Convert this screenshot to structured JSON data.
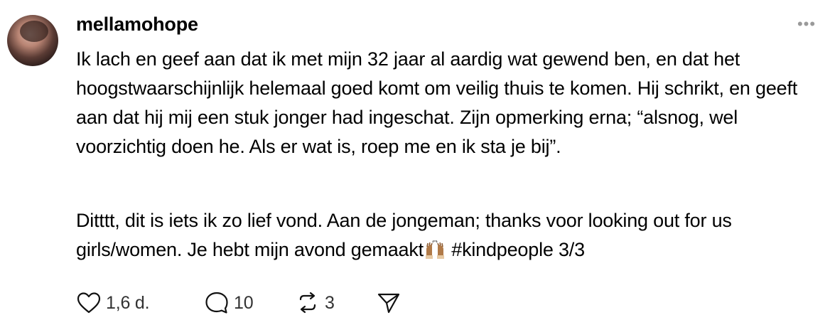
{
  "post": {
    "username": "mellamohope",
    "more_label": "•••",
    "paragraph1": "Ik lach en geef aan dat ik met mijn 32 jaar al aardig wat gewend ben, en dat het hoogstwaarschijnlijk helemaal goed komt om veilig thuis te komen. Hij schrikt, en geeft aan dat hij mij een stuk jonger had ingeschat. Zijn opmerking erna; “alsnog, wel voorzichtig doen he. Als er wat is, roep me en ik sta je bij”.",
    "paragraph2_before": "Ditttt, dit is iets ik zo lief vond. Aan de jongeman; thanks voor looking out for us girls/women. Je hebt mijn avond gemaakt",
    "paragraph2_after": " #kindpeople 3/3",
    "emoji": "raising-hands-emoji"
  },
  "actions": {
    "likes": "1,6 d.",
    "replies": "10",
    "reposts": "3",
    "icons": [
      "heart-icon",
      "comment-icon",
      "repost-icon",
      "share-icon"
    ]
  }
}
